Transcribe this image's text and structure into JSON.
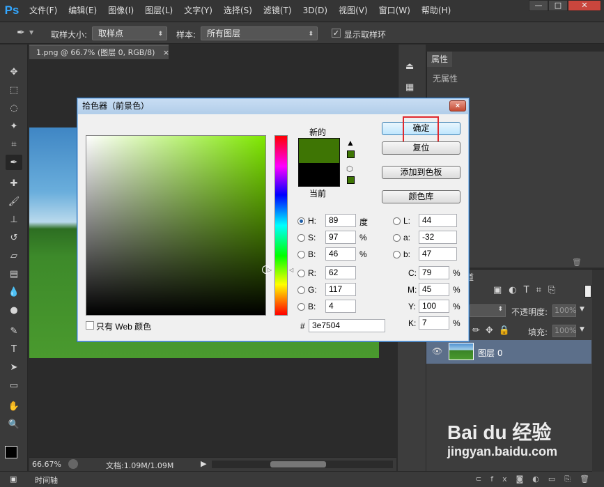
{
  "menubar": {
    "logo": "Ps",
    "items": [
      "文件(F)",
      "编辑(E)",
      "图像(I)",
      "图层(L)",
      "文字(Y)",
      "选择(S)",
      "滤镜(T)",
      "3D(D)",
      "视图(V)",
      "窗口(W)",
      "帮助(H)"
    ]
  },
  "options": {
    "sample_size_label": "取样大小:",
    "sample_size_value": "取样点",
    "sample_label": "样本:",
    "sample_value": "所有图层",
    "show_ring_label": "显示取样环",
    "show_ring_checked": true
  },
  "document": {
    "tab_title": "1.png @ 66.7% (图层 0, RGB/8)",
    "tab_close": "×",
    "zoom": "66.67%",
    "doc_info": "文档:1.09M/1.09M"
  },
  "timeline": {
    "label": "时间轴"
  },
  "panels": {
    "properties_tab": "属性",
    "properties_empty": "无属性",
    "channels_tab": "通道",
    "opacity_label": "不透明度:",
    "opacity_value": "100%",
    "fill_label": "填充:",
    "fill_value": "100%",
    "layer_name": "图层 0"
  },
  "picker": {
    "title": "拾色器（前景色）",
    "close": "×",
    "new_label": "新的",
    "current_label": "当前",
    "new_color": "#3e7504",
    "current_color": "#000000",
    "ok": "确定",
    "reset": "复位",
    "add_to_swatches": "添加到色板",
    "color_libraries": "颜色库",
    "web_only_label": "只有 Web 颜色",
    "fields": {
      "H": {
        "label": "H:",
        "value": "89",
        "unit": "度"
      },
      "S": {
        "label": "S:",
        "value": "97",
        "unit": "%"
      },
      "Bv": {
        "label": "B:",
        "value": "46",
        "unit": "%"
      },
      "R": {
        "label": "R:",
        "value": "62"
      },
      "G": {
        "label": "G:",
        "value": "117"
      },
      "Bc": {
        "label": "B:",
        "value": "4"
      },
      "L": {
        "label": "L:",
        "value": "44"
      },
      "a": {
        "label": "a:",
        "value": "-32"
      },
      "b": {
        "label": "b:",
        "value": "47"
      },
      "C": {
        "label": "C:",
        "value": "79",
        "unit": "%"
      },
      "M": {
        "label": "M:",
        "value": "45",
        "unit": "%"
      },
      "Y": {
        "label": "Y:",
        "value": "100",
        "unit": "%"
      },
      "K": {
        "label": "K:",
        "value": "7",
        "unit": "%"
      }
    },
    "hex_label": "#",
    "hex_value": "3e7504"
  },
  "watermark": {
    "brand": "Bai du 经验",
    "url": "jingyan.baidu.com"
  }
}
